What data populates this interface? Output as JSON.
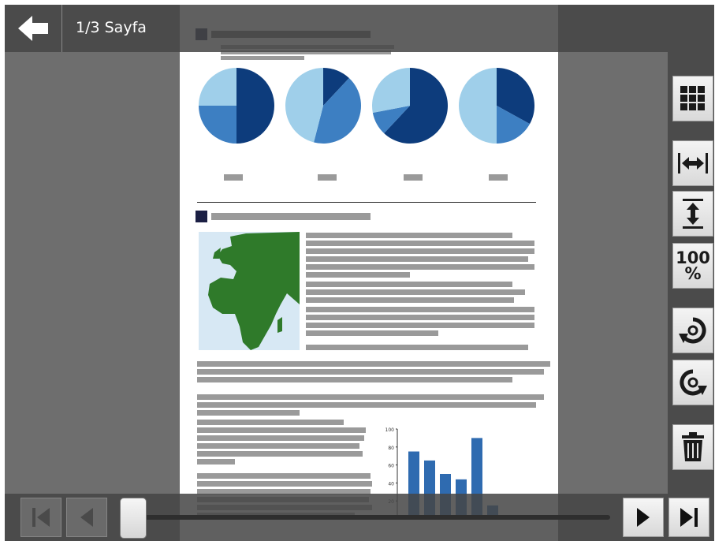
{
  "toolbar": {
    "page_indicator": "1/3 Sayfa",
    "back_icon": "arrow-left-icon",
    "right_buttons": [
      {
        "icon": "grid-icon"
      },
      {
        "icon": "fit-width-icon"
      },
      {
        "icon": "fit-height-icon"
      },
      {
        "icon": "zoom-100-icon",
        "label_top": "100",
        "label_bottom": "%"
      },
      {
        "icon": "rotate-left-icon"
      },
      {
        "icon": "rotate-right-icon"
      },
      {
        "icon": "trash-icon"
      }
    ]
  },
  "navigation": {
    "first_icon": "first-page-icon",
    "prev_icon": "previous-page-icon",
    "next_icon": "next-page-icon",
    "last_icon": "last-page-icon",
    "slider_position": 0
  },
  "document": {
    "bar_chart": {
      "y_ticks": [
        "100",
        "80",
        "60",
        "40",
        "20"
      ],
      "values": [
        75,
        65,
        50,
        44,
        90,
        15
      ]
    },
    "pie_charts": [
      [
        0.5,
        0.25,
        0.25
      ],
      [
        0.12,
        0.42,
        0.46
      ],
      [
        0.62,
        0.1,
        0.28
      ],
      [
        0.33,
        0.17,
        0.5
      ]
    ]
  },
  "colors": {
    "pie_dark": "#0d3c7c",
    "pie_mid": "#3d7fc2",
    "pie_light": "#9fcfea",
    "map_land": "#2f7a2a",
    "map_sea": "#d7e8f4",
    "bar_fill": "#2f6bb0"
  }
}
